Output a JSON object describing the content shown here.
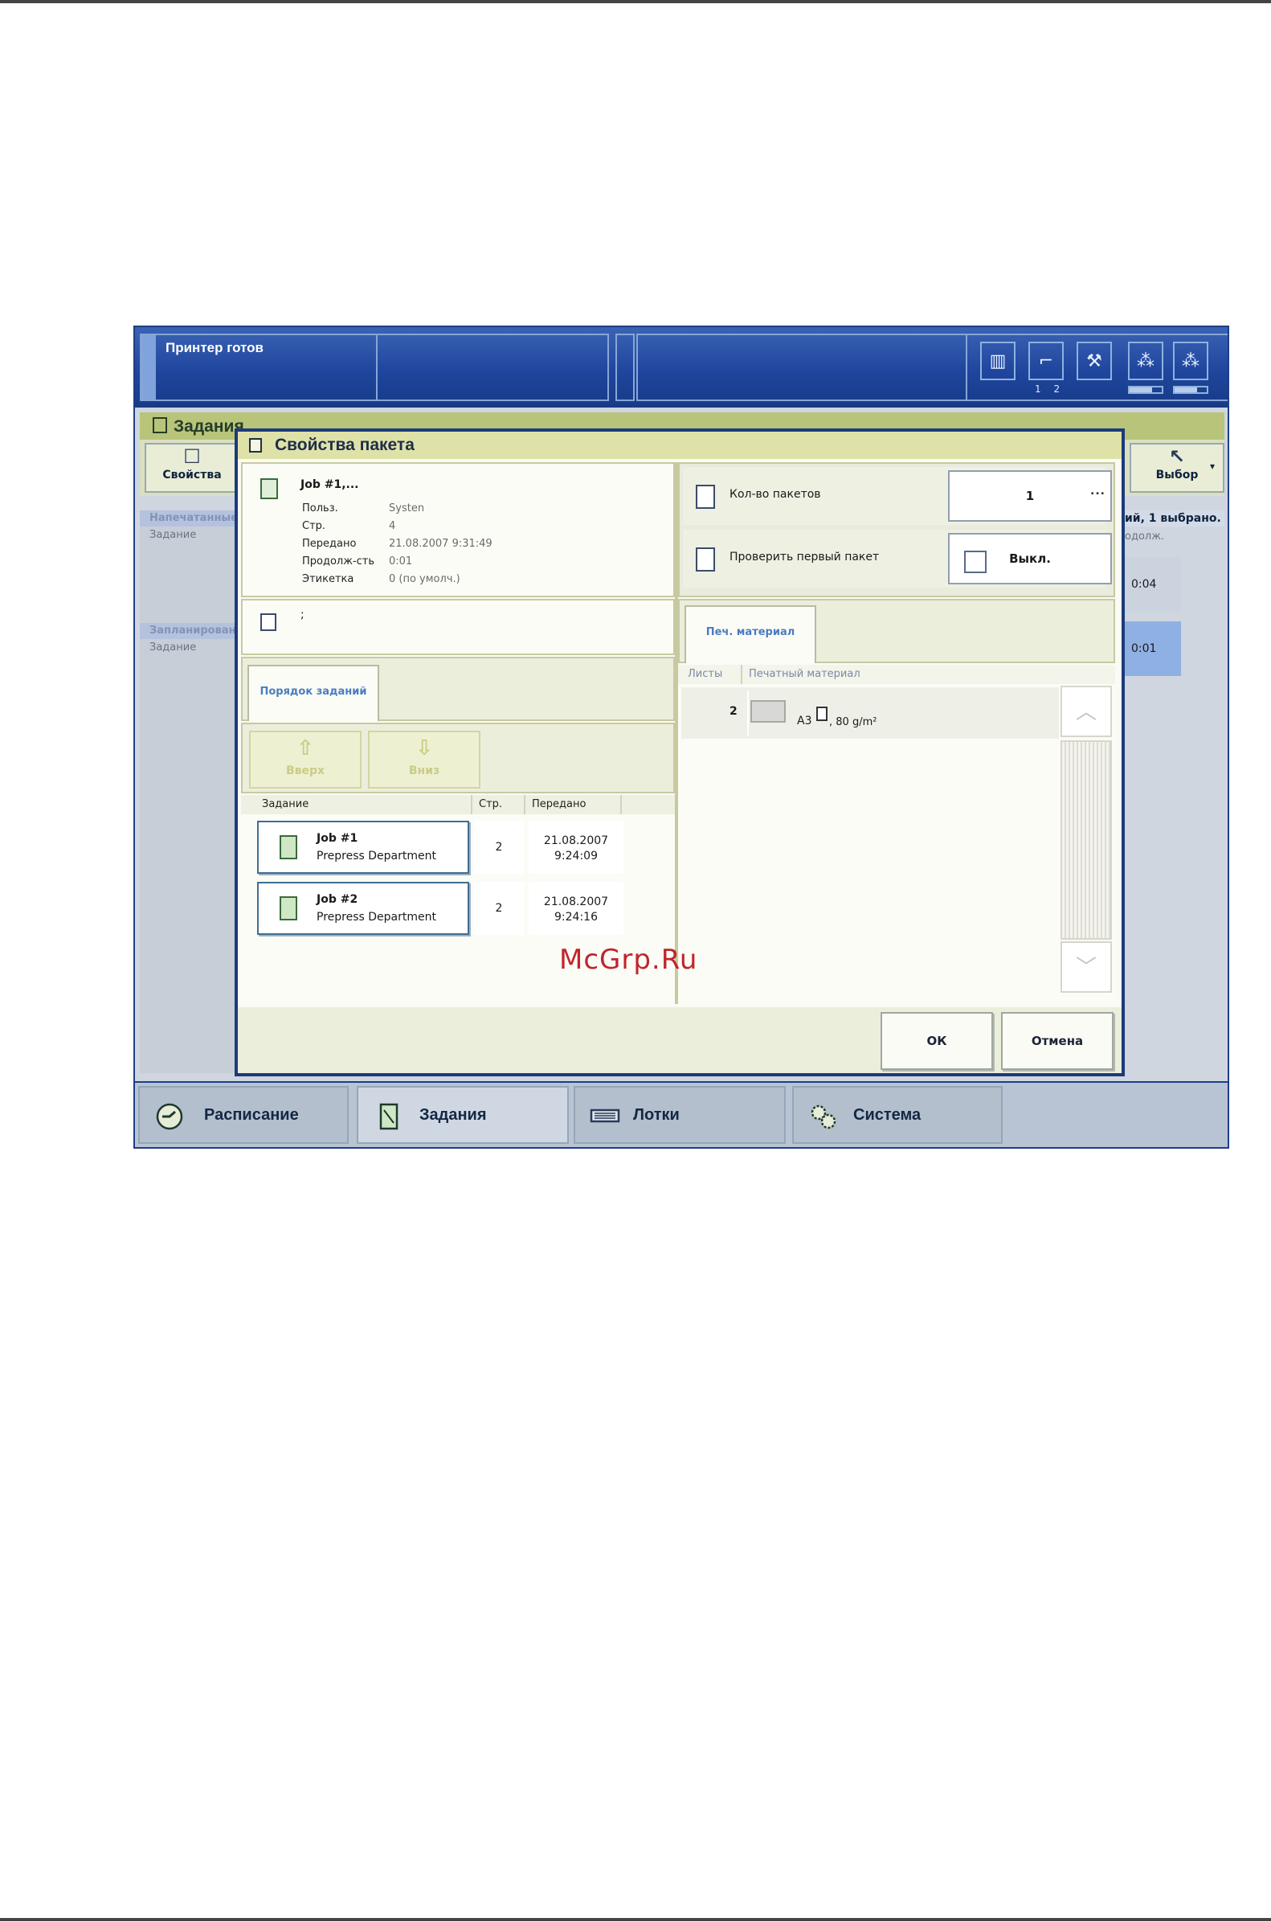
{
  "status": {
    "text": "Принтер готов",
    "tray_numbers": "1 2"
  },
  "app": {
    "title": "Задания",
    "toolbar": {
      "properties": "Свойства",
      "select": "Выбор"
    },
    "sections": {
      "printed": "Напечатанные",
      "scheduled": "Запланирован"
    },
    "col_job": "Задание",
    "summary": "ий, 1 выбрано.",
    "col_duration": "одолж.",
    "durations": [
      "0:04",
      "0:01"
    ]
  },
  "dialog": {
    "title": "Свойства пакета",
    "job_title": "Job #1,...",
    "fields": [
      {
        "label": "Польз.",
        "value": "Systen"
      },
      {
        "label": "Стр.",
        "value": "4"
      },
      {
        "label": "Передано",
        "value": "21.08.2007 9:31:49"
      },
      {
        "label": "Продолж-сть",
        "value": "0:01"
      },
      {
        "label": "Этикетка",
        "value": "0 (по умолч.)"
      }
    ],
    "note": ";",
    "order_tab": "Порядок заданий",
    "up": "Вверх",
    "down": "Вниз",
    "table_headers": {
      "job": "Задание",
      "pages": "Стр.",
      "sent": "Передано"
    },
    "jobs": [
      {
        "name": "Job #1",
        "dept": "Prepress Department",
        "pages": "2",
        "date": "21.08.2007",
        "time": "9:24:09"
      },
      {
        "name": "Job #2",
        "dept": "Prepress Department",
        "pages": "2",
        "date": "21.08.2007",
        "time": "9:24:16"
      }
    ],
    "copies_label": "Кол-во пакетов",
    "copies_value": "1",
    "check_label": "Проверить первый пакет",
    "check_value": "Выкл.",
    "dots": "...",
    "media_tab": "Печ. материал",
    "media_headers": {
      "sheets": "Листы",
      "media": "Печатный материал"
    },
    "media_row": {
      "sheets": "2",
      "size": "A3",
      "weight": ", 80 g/m²"
    },
    "ok": "ОК",
    "cancel": "Отмена"
  },
  "nav": {
    "schedule": "Расписание",
    "jobs": "Задания",
    "trays": "Лотки",
    "system": "Система"
  },
  "watermark": "McGrp.Ru",
  "colors": {
    "accent_blue": "#1f469d",
    "dialog_title": "#dfe2a8",
    "watermark": "#c0252b"
  }
}
